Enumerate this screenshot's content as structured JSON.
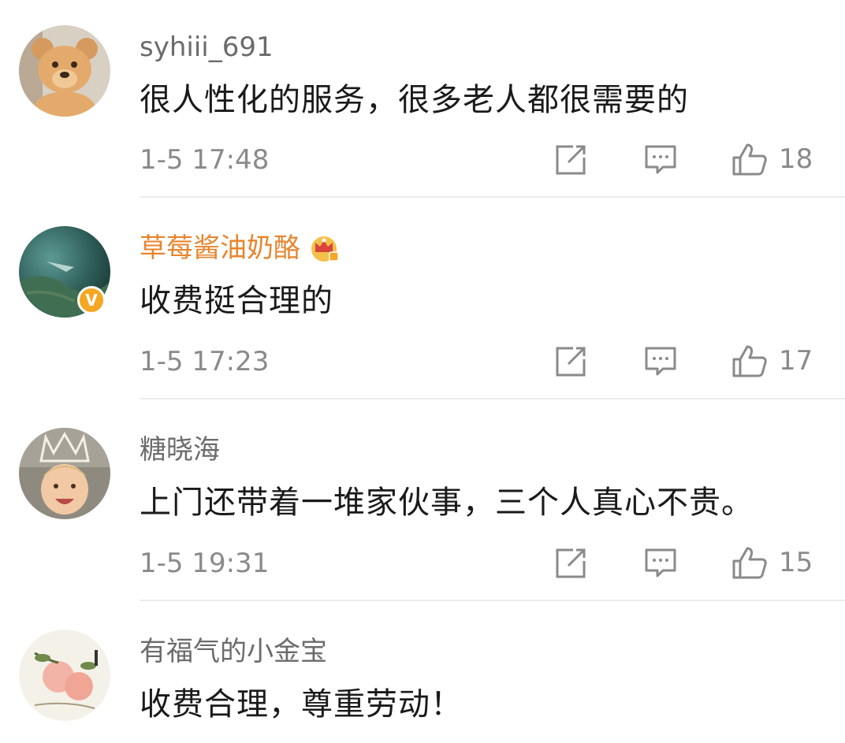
{
  "comments": [
    {
      "username": "syhiii_691",
      "text": "很人性化的服务，很多老人都很需要的",
      "time": "1-5 17:48",
      "likes": "18",
      "avatar_icon": "teddy-bear-avatar"
    },
    {
      "username": "草莓酱油奶酪",
      "username_color": "#e8842d",
      "verified_badge": "V",
      "text": "收费挺合理的",
      "time": "1-5 17:23",
      "likes": "17",
      "avatar_icon": "underwater-photo-avatar"
    },
    {
      "username": "糖晓海",
      "text": "上门还带着一堆家伙事，三个人真心不贵。",
      "time": "1-5 19:31",
      "likes": "15",
      "avatar_icon": "baby-crown-avatar"
    },
    {
      "username": "有福气的小金宝",
      "text": "收费合理，尊重劳动！",
      "avatar_icon": "peach-painting-avatar"
    }
  ],
  "icons": {
    "share": "share-icon",
    "comment": "comment-icon",
    "like": "thumbs-up-icon",
    "vip": "crown-icon"
  },
  "colors": {
    "accent": "#e8842d",
    "verified": "#f5a623",
    "meta_text": "#8a8a8a"
  }
}
